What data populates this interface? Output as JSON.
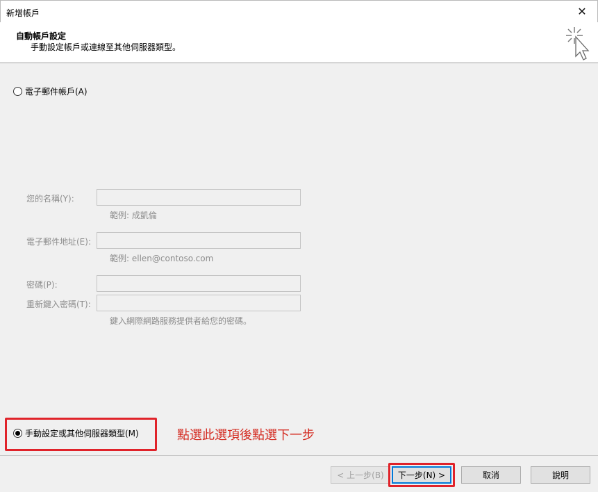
{
  "window": {
    "title": "新增帳戶",
    "close_glyph": "✕"
  },
  "header": {
    "title": "自動帳戶設定",
    "subtitle": "手動設定帳戶或連線至其他伺服器類型。",
    "icon": "wizard-cursor-icon"
  },
  "options": {
    "email_account": {
      "label": "電子郵件帳戶(A)",
      "checked": false
    },
    "manual_setup": {
      "label": "手動設定或其他伺服器類型(M)",
      "checked": true
    }
  },
  "form": {
    "name": {
      "label": "您的名稱(Y):",
      "value": "",
      "hint": "範例: 成凱倫"
    },
    "email": {
      "label": "電子郵件地址(E):",
      "value": "",
      "hint": "範例: ellen@contoso.com"
    },
    "password": {
      "label": "密碼(P):",
      "value": ""
    },
    "retype_password": {
      "label": "重新鍵入密碼(T):",
      "value": "",
      "hint": "鍵入網際網路服務提供者給您的密碼。"
    }
  },
  "annotation": {
    "text": "點選此選項後點選下一步",
    "color": "#d42b21"
  },
  "buttons": {
    "back": "< 上一步(B)",
    "next": "下一步(N) >",
    "cancel": "取消",
    "help": "說明"
  },
  "colors": {
    "highlight": "#e0232a",
    "accent": "#0078d7"
  }
}
